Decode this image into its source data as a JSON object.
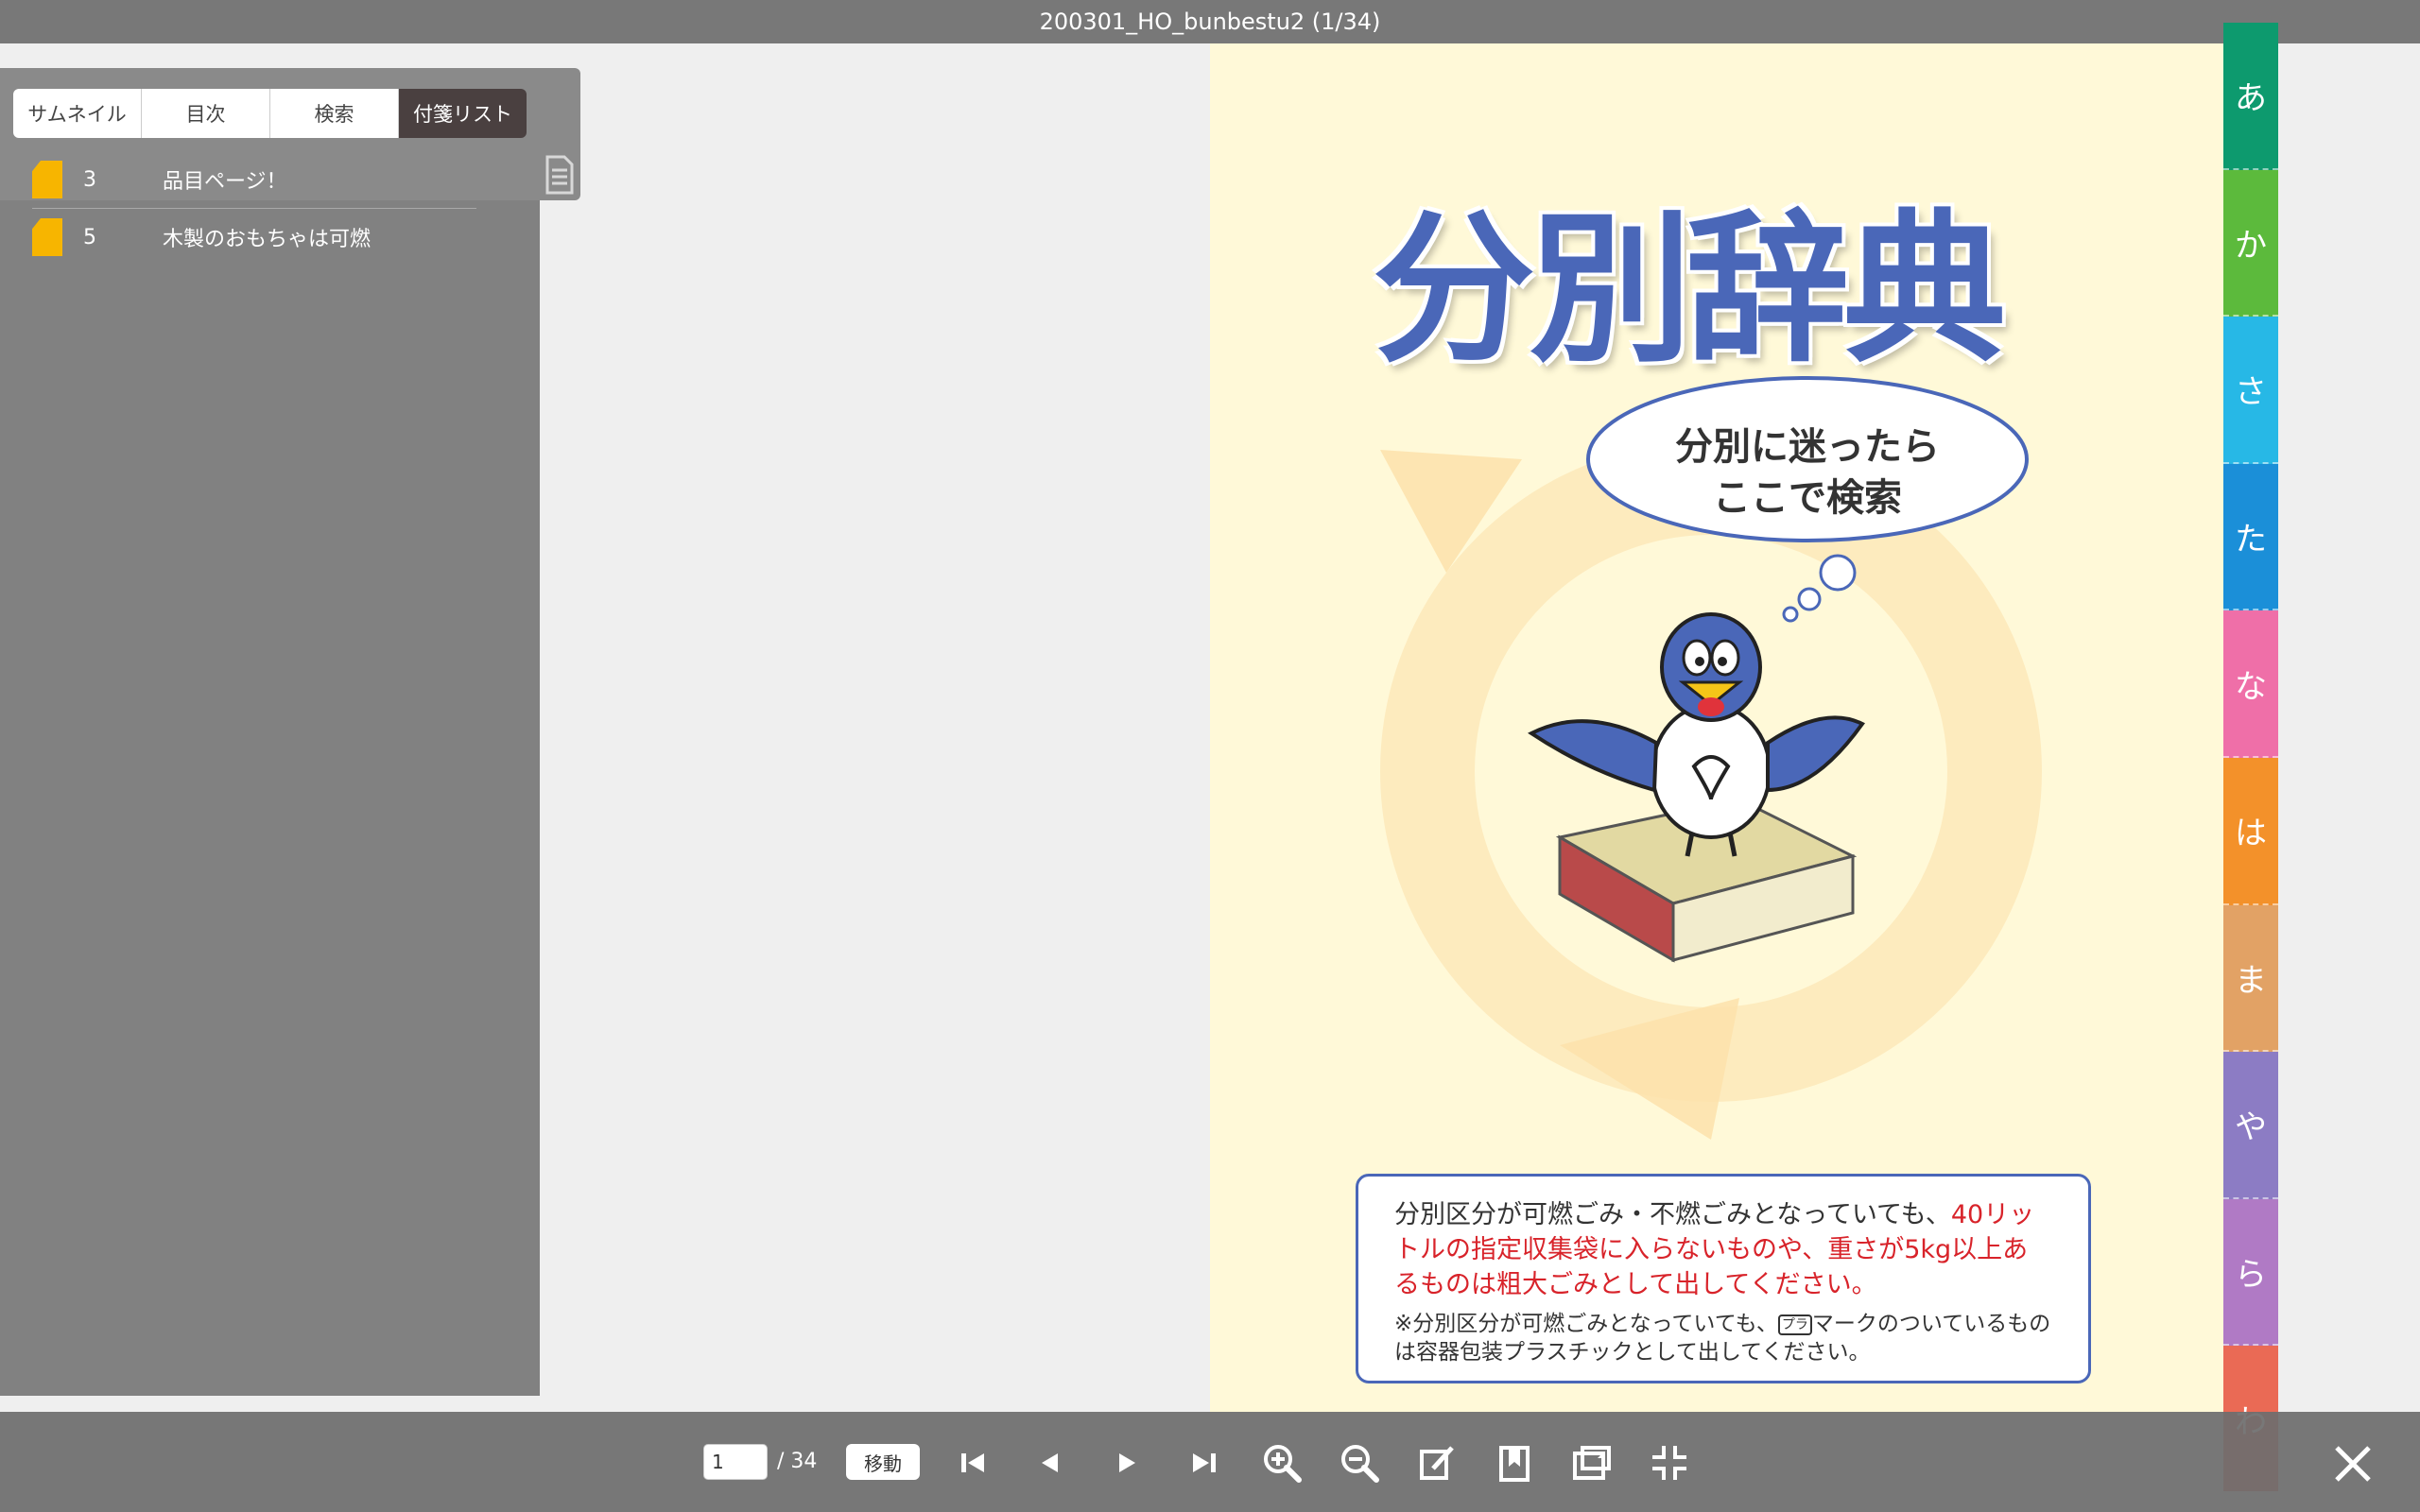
{
  "window": {
    "title": "200301_HO_bunbestu2 (1/34)"
  },
  "panel": {
    "tabs": [
      {
        "label": "サムネイル",
        "active": false
      },
      {
        "label": "目次",
        "active": false
      },
      {
        "label": "検索",
        "active": false
      },
      {
        "label": "付箋リスト",
        "active": true
      }
    ],
    "export_icon": "document-icon",
    "notes": [
      {
        "page": "3",
        "text": "品目ページ！"
      },
      {
        "page": "5",
        "text": "木製のおもちゃは可燃"
      }
    ]
  },
  "page": {
    "title": "分別辞典",
    "bubble_line1": "分別に迷ったら",
    "bubble_line2": "ここで検索",
    "notice_text1": "分別区分が可燃ごみ・不燃ごみとなっていても、",
    "notice_red": "40リットルの指定収集袋に入らないものや、重さが5kg以上あるものは粗大ごみとして出してください。",
    "notice_sub_pre": "※分別区分が可燃ごみとなっていても、",
    "notice_mark": "プラ",
    "notice_sub_post": "マークのついているものは容器包装プラスチックとして出してください。"
  },
  "index_tabs": [
    {
      "label": "あ",
      "color": "#0d9a6e"
    },
    {
      "label": "か",
      "color": "#5cba3c"
    },
    {
      "label": "さ",
      "color": "#27b8e6"
    },
    {
      "label": "た",
      "color": "#1b8fd8"
    },
    {
      "label": "な",
      "color": "#ef6fa8"
    },
    {
      "label": "は",
      "color": "#f3912a"
    },
    {
      "label": "ま",
      "color": "#e2a265"
    },
    {
      "label": "や",
      "color": "#8c7cc4"
    },
    {
      "label": "ら",
      "color": "#b07ac5"
    },
    {
      "label": "わ",
      "color": "#ea6a55"
    }
  ],
  "bottom": {
    "page_value": "1",
    "page_total": "/ 34",
    "move_label": "移動",
    "icons": [
      "first-page-icon",
      "prev-page-icon",
      "next-page-icon",
      "last-page-icon",
      "zoom-in-icon",
      "zoom-out-icon",
      "edit-note-icon",
      "bookmark-icon",
      "share-icon",
      "exit-fullscreen-icon",
      "close-icon"
    ]
  }
}
